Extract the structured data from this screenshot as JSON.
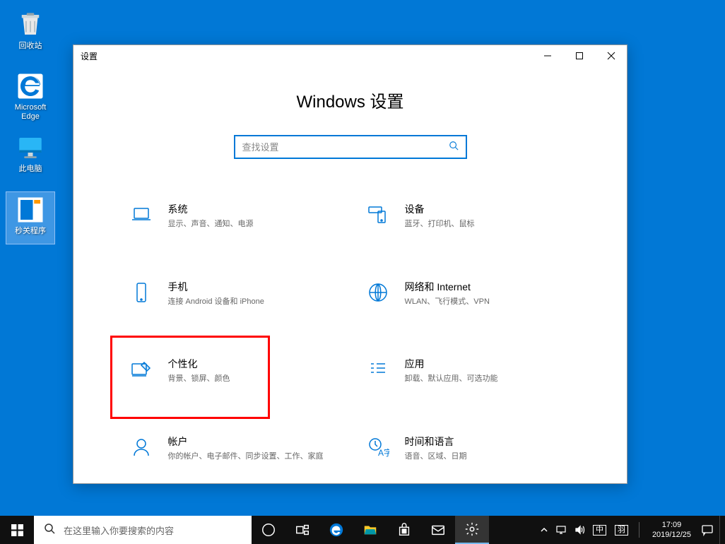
{
  "desktop": {
    "icons": [
      {
        "name": "recycle-bin",
        "label": "回收站"
      },
      {
        "name": "edge",
        "label": "Microsoft Edge"
      },
      {
        "name": "this-pc",
        "label": "此电脑"
      },
      {
        "name": "quick-close",
        "label": "秒关程序"
      }
    ]
  },
  "window": {
    "title": "设置",
    "heading": "Windows 设置",
    "search_placeholder": "查找设置"
  },
  "categories": [
    {
      "id": "system",
      "title": "系统",
      "desc": "显示、声音、通知、电源"
    },
    {
      "id": "devices",
      "title": "设备",
      "desc": "蓝牙、打印机、鼠标"
    },
    {
      "id": "phone",
      "title": "手机",
      "desc": "连接 Android 设备和 iPhone"
    },
    {
      "id": "network",
      "title": "网络和 Internet",
      "desc": "WLAN、飞行模式、VPN"
    },
    {
      "id": "personalization",
      "title": "个性化",
      "desc": "背景、锁屏、颜色",
      "highlighted": true
    },
    {
      "id": "apps",
      "title": "应用",
      "desc": "卸载、默认应用、可选功能"
    },
    {
      "id": "accounts",
      "title": "帐户",
      "desc": "你的帐户、电子邮件、同步设置、工作、家庭"
    },
    {
      "id": "time-language",
      "title": "时间和语言",
      "desc": "语音、区域、日期"
    }
  ],
  "taskbar": {
    "search_placeholder": "在这里输入你要搜索的内容",
    "ime1": "中",
    "ime2": "羽",
    "time": "17:09",
    "date": "2019/12/25"
  }
}
